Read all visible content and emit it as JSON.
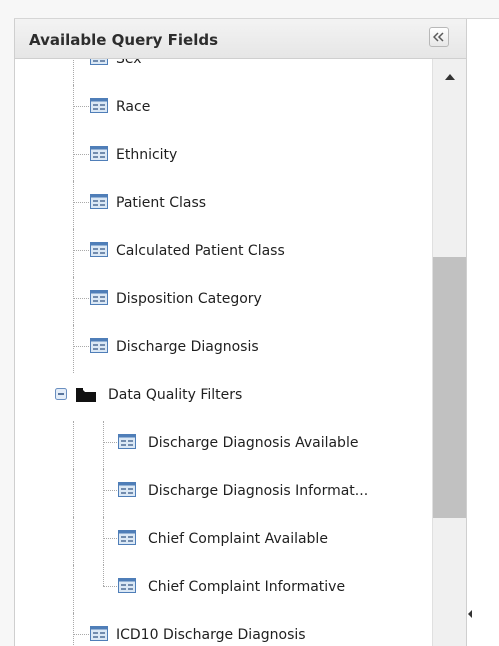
{
  "panel": {
    "title": "Available Query Fields",
    "collapse_icon": "double-chevron-left-icon"
  },
  "tree": {
    "items": [
      {
        "label": "Sex",
        "type": "field",
        "level": 1
      },
      {
        "label": "Race",
        "type": "field",
        "level": 1
      },
      {
        "label": "Ethnicity",
        "type": "field",
        "level": 1
      },
      {
        "label": "Patient Class",
        "type": "field",
        "level": 1
      },
      {
        "label": "Calculated Patient Class",
        "type": "field",
        "level": 1
      },
      {
        "label": "Disposition Category",
        "type": "field",
        "level": 1
      },
      {
        "label": "Discharge Diagnosis",
        "type": "field",
        "level": 1
      },
      {
        "label": "Data Quality Filters",
        "type": "folder",
        "level": 1,
        "expanded": true
      },
      {
        "label": "Discharge Diagnosis Available",
        "type": "field",
        "level": 2
      },
      {
        "label": "Discharge Diagnosis Informat...",
        "type": "field",
        "level": 2
      },
      {
        "label": "Chief Complaint Available",
        "type": "field",
        "level": 2
      },
      {
        "label": "Chief Complaint Informative",
        "type": "field",
        "level": 2
      },
      {
        "label": "ICD10 Discharge Diagnosis",
        "type": "field",
        "level": 1
      }
    ]
  },
  "scrollbar": {
    "position": 0.56,
    "up_icon": "scroll-up-arrow-icon"
  },
  "colors": {
    "field_icon_fill": "#dbe8f5",
    "field_icon_border": "#4f7eb8",
    "folder": "#111111",
    "scroll_thumb": "#c1c1c1"
  }
}
